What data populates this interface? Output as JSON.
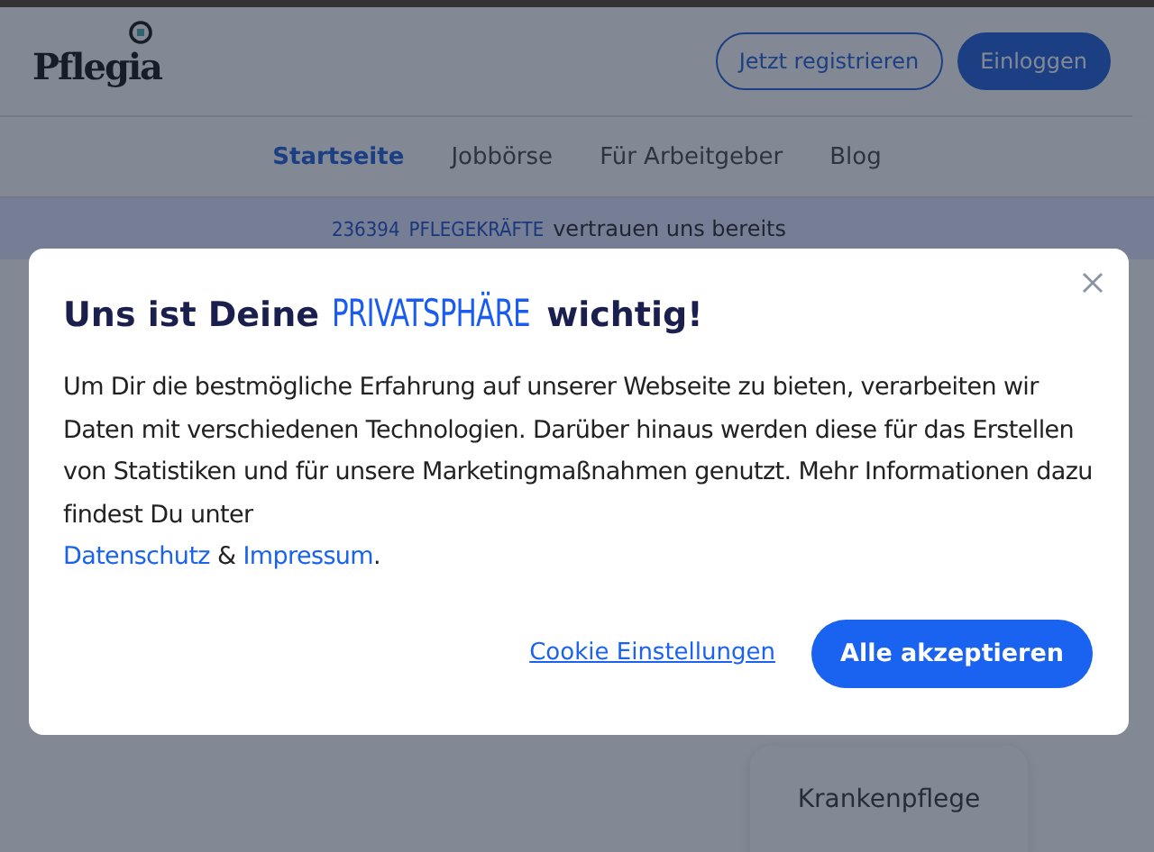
{
  "header": {
    "logo": "Pflegia",
    "buttons": [
      {
        "label": "Jetzt registrieren",
        "kind": "outline"
      },
      {
        "label": "Einloggen",
        "kind": "filled"
      }
    ]
  },
  "nav": [
    {
      "label": "Startseite",
      "selected": true
    },
    {
      "label": "Jobbörse",
      "selected": false
    },
    {
      "label": "Für Arbeitgeber",
      "selected": false
    },
    {
      "label": "Blog",
      "selected": false
    }
  ],
  "banner": {
    "count": "236394",
    "highlight": "PFLEGEKRÄFTE",
    "text": "vertrauen uns bereits"
  },
  "category_card": {
    "label": "Krankenpflege"
  },
  "modal": {
    "title_before": "Uns ist Deine",
    "title_highlight": "PRIVATSPHÄRE",
    "title_after": "wichtig!",
    "body": "Um Dir die bestmögliche Erfahrung auf unserer Webseite zu bieten, verarbeiten wir Daten mit verschiedenen Technologien. Darüber hinaus werden diese für das Erstellen von Statistiken und für unsere Marketingmaßnahmen genutzt. Mehr Informationen dazu findest Du unter",
    "links": [
      "Datenschutz",
      "Impressum"
    ],
    "joiner": "&",
    "end": ".",
    "settings_link": "Cookie Einstellungen",
    "accept_button": "Alle akzeptieren"
  }
}
